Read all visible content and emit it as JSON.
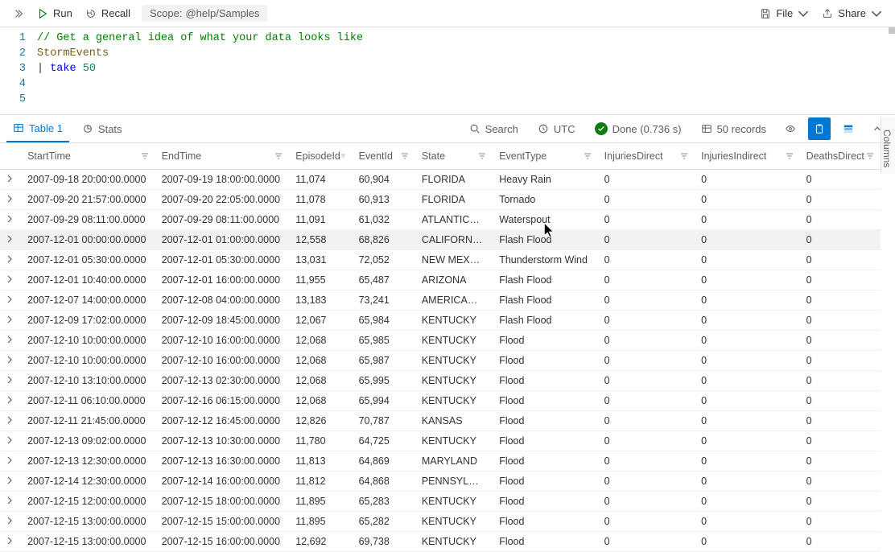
{
  "toolbar": {
    "run": "Run",
    "recall": "Recall",
    "scope_label": "Scope:",
    "scope_value": "@help/Samples",
    "file": "File",
    "share": "Share"
  },
  "editor": {
    "lines": [
      {
        "n": "1",
        "kind": "comment",
        "text": "// Get a general idea of what your data looks like"
      },
      {
        "n": "2",
        "kind": "ident",
        "text": "StormEvents"
      },
      {
        "n": "3",
        "kind": "pipe",
        "kw": "take",
        "num": "50"
      },
      {
        "n": "4",
        "kind": "blank"
      },
      {
        "n": "5",
        "kind": "blank"
      }
    ]
  },
  "tabs": {
    "table": "Table 1",
    "stats": "Stats",
    "search": "Search",
    "tz": "UTC",
    "done": "Done (0.736 s)",
    "records": "50 records"
  },
  "side_panel": "Columns",
  "columns": [
    "StartTime",
    "EndTime",
    "EpisodeId",
    "EventId",
    "State",
    "EventType",
    "InjuriesDirect",
    "InjuriesIndirect",
    "DeathsDirect"
  ],
  "rows": [
    {
      "StartTime": "2007-09-18 20:00:00.0000",
      "EndTime": "2007-09-19 18:00:00.0000",
      "EpisodeId": "11,074",
      "EventId": "60,904",
      "State": "FLORIDA",
      "EventType": "Heavy Rain",
      "InjuriesDirect": "0",
      "InjuriesIndirect": "0",
      "DeathsDirect": "0"
    },
    {
      "StartTime": "2007-09-20 21:57:00.0000",
      "EndTime": "2007-09-20 22:05:00.0000",
      "EpisodeId": "11,078",
      "EventId": "60,913",
      "State": "FLORIDA",
      "EventType": "Tornado",
      "InjuriesDirect": "0",
      "InjuriesIndirect": "0",
      "DeathsDirect": "0"
    },
    {
      "StartTime": "2007-09-29 08:11:00.0000",
      "EndTime": "2007-09-29 08:11:00.0000",
      "EpisodeId": "11,091",
      "EventId": "61,032",
      "State": "ATLANTIC…",
      "EventType": "Waterspout",
      "InjuriesDirect": "0",
      "InjuriesIndirect": "0",
      "DeathsDirect": "0"
    },
    {
      "StartTime": "2007-12-01 00:00:00.0000",
      "EndTime": "2007-12-01 01:00:00.0000",
      "EpisodeId": "12,558",
      "EventId": "68,826",
      "State": "CALIFORN…",
      "EventType": "Flash Flood",
      "InjuriesDirect": "0",
      "InjuriesIndirect": "0",
      "DeathsDirect": "0",
      "hover": true
    },
    {
      "StartTime": "2007-12-01 05:30:00.0000",
      "EndTime": "2007-12-01 05:30:00.0000",
      "EpisodeId": "13,031",
      "EventId": "72,052",
      "State": "NEW MEX…",
      "EventType": "Thunderstorm Wind",
      "InjuriesDirect": "0",
      "InjuriesIndirect": "0",
      "DeathsDirect": "0"
    },
    {
      "StartTime": "2007-12-01 10:40:00.0000",
      "EndTime": "2007-12-01 16:00:00.0000",
      "EpisodeId": "11,955",
      "EventId": "65,487",
      "State": "ARIZONA",
      "EventType": "Flash Flood",
      "InjuriesDirect": "0",
      "InjuriesIndirect": "0",
      "DeathsDirect": "0"
    },
    {
      "StartTime": "2007-12-07 14:00:00.0000",
      "EndTime": "2007-12-08 04:00:00.0000",
      "EpisodeId": "13,183",
      "EventId": "73,241",
      "State": "AMERICA…",
      "EventType": "Flash Flood",
      "InjuriesDirect": "0",
      "InjuriesIndirect": "0",
      "DeathsDirect": "0"
    },
    {
      "StartTime": "2007-12-09 17:02:00.0000",
      "EndTime": "2007-12-09 18:45:00.0000",
      "EpisodeId": "12,067",
      "EventId": "65,984",
      "State": "KENTUCKY",
      "EventType": "Flash Flood",
      "InjuriesDirect": "0",
      "InjuriesIndirect": "0",
      "DeathsDirect": "0"
    },
    {
      "StartTime": "2007-12-10 10:00:00.0000",
      "EndTime": "2007-12-10 16:00:00.0000",
      "EpisodeId": "12,068",
      "EventId": "65,985",
      "State": "KENTUCKY",
      "EventType": "Flood",
      "InjuriesDirect": "0",
      "InjuriesIndirect": "0",
      "DeathsDirect": "0"
    },
    {
      "StartTime": "2007-12-10 10:00:00.0000",
      "EndTime": "2007-12-10 16:00:00.0000",
      "EpisodeId": "12,068",
      "EventId": "65,987",
      "State": "KENTUCKY",
      "EventType": "Flood",
      "InjuriesDirect": "0",
      "InjuriesIndirect": "0",
      "DeathsDirect": "0"
    },
    {
      "StartTime": "2007-12-10 13:10:00.0000",
      "EndTime": "2007-12-13 02:30:00.0000",
      "EpisodeId": "12,068",
      "EventId": "65,995",
      "State": "KENTUCKY",
      "EventType": "Flood",
      "InjuriesDirect": "0",
      "InjuriesIndirect": "0",
      "DeathsDirect": "0"
    },
    {
      "StartTime": "2007-12-11 06:10:00.0000",
      "EndTime": "2007-12-16 06:15:00.0000",
      "EpisodeId": "12,068",
      "EventId": "65,994",
      "State": "KENTUCKY",
      "EventType": "Flood",
      "InjuriesDirect": "0",
      "InjuriesIndirect": "0",
      "DeathsDirect": "0"
    },
    {
      "StartTime": "2007-12-11 21:45:00.0000",
      "EndTime": "2007-12-12 16:45:00.0000",
      "EpisodeId": "12,826",
      "EventId": "70,787",
      "State": "KANSAS",
      "EventType": "Flood",
      "InjuriesDirect": "0",
      "InjuriesIndirect": "0",
      "DeathsDirect": "0"
    },
    {
      "StartTime": "2007-12-13 09:02:00.0000",
      "EndTime": "2007-12-13 10:30:00.0000",
      "EpisodeId": "11,780",
      "EventId": "64,725",
      "State": "KENTUCKY",
      "EventType": "Flood",
      "InjuriesDirect": "0",
      "InjuriesIndirect": "0",
      "DeathsDirect": "0"
    },
    {
      "StartTime": "2007-12-13 12:30:00.0000",
      "EndTime": "2007-12-13 16:30:00.0000",
      "EpisodeId": "11,813",
      "EventId": "64,869",
      "State": "MARYLAND",
      "EventType": "Flood",
      "InjuriesDirect": "0",
      "InjuriesIndirect": "0",
      "DeathsDirect": "0"
    },
    {
      "StartTime": "2007-12-14 12:30:00.0000",
      "EndTime": "2007-12-14 16:00:00.0000",
      "EpisodeId": "11,812",
      "EventId": "64,868",
      "State": "PENNSYL…",
      "EventType": "Flood",
      "InjuriesDirect": "0",
      "InjuriesIndirect": "0",
      "DeathsDirect": "0"
    },
    {
      "StartTime": "2007-12-15 12:00:00.0000",
      "EndTime": "2007-12-15 18:00:00.0000",
      "EpisodeId": "11,895",
      "EventId": "65,283",
      "State": "KENTUCKY",
      "EventType": "Flood",
      "InjuriesDirect": "0",
      "InjuriesIndirect": "0",
      "DeathsDirect": "0"
    },
    {
      "StartTime": "2007-12-15 13:00:00.0000",
      "EndTime": "2007-12-15 15:00:00.0000",
      "EpisodeId": "11,895",
      "EventId": "65,282",
      "State": "KENTUCKY",
      "EventType": "Flood",
      "InjuriesDirect": "0",
      "InjuriesIndirect": "0",
      "DeathsDirect": "0"
    },
    {
      "StartTime": "2007-12-15 13:00:00.0000",
      "EndTime": "2007-12-15 16:00:00.0000",
      "EpisodeId": "12,692",
      "EventId": "69,738",
      "State": "KENTUCKY",
      "EventType": "Flood",
      "InjuriesDirect": "0",
      "InjuriesIndirect": "0",
      "DeathsDirect": "0"
    }
  ]
}
